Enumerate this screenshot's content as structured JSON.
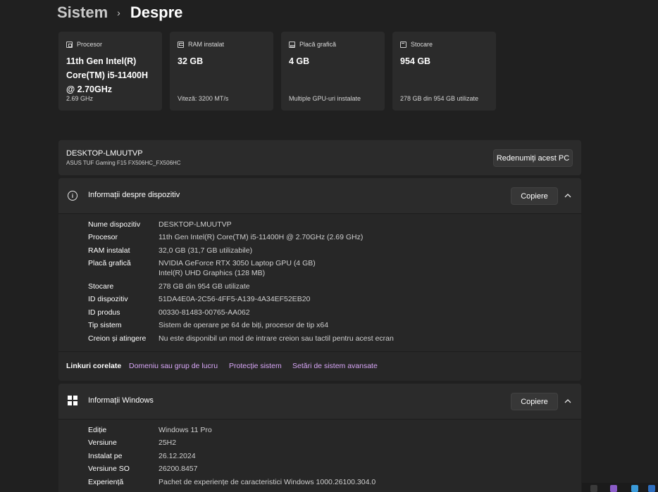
{
  "breadcrumb": {
    "parent": "Sistem",
    "separator": "›",
    "current": "Despre"
  },
  "specs": [
    {
      "icon": "processor-icon",
      "label": "Procesor",
      "value": "11th Gen Intel(R) Core(TM) i5-11400H @ 2.70GHz",
      "sub": "2.69 GHz"
    },
    {
      "icon": "ram-icon",
      "label": "RAM instalat",
      "value": "32 GB",
      "sub": "Viteză: 3200 MT/s"
    },
    {
      "icon": "gpu-icon",
      "label": "Placă grafică",
      "value": "4 GB",
      "sub": "Multiple GPU-uri instalate"
    },
    {
      "icon": "storage-icon",
      "label": "Stocare",
      "value": "954 GB",
      "sub": "278 GB din 954 GB utilizate"
    }
  ],
  "device": {
    "name": "DESKTOP-LMUUTVP",
    "model": "ASUS TUF Gaming F15 FX506HC_FX506HC",
    "rename_label": "Redenumiți acest PC"
  },
  "device_info": {
    "title": "Informații despre dispozitiv",
    "copy_label": "Copiere",
    "rows": [
      {
        "key": "Nume dispozitiv",
        "value": "DESKTOP-LMUUTVP"
      },
      {
        "key": "Procesor",
        "value": "11th Gen Intel(R) Core(TM) i5-11400H @ 2.70GHz (2.69 GHz)"
      },
      {
        "key": "RAM instalat",
        "value": "32,0 GB (31,7 GB utilizabile)"
      },
      {
        "key": "Placă grafică",
        "value": "NVIDIA GeForce RTX 3050 Laptop GPU (4 GB)",
        "value2": "Intel(R) UHD Graphics (128 MB)"
      },
      {
        "key": "Stocare",
        "value": "278 GB din 954 GB utilizate"
      },
      {
        "key": "ID dispozitiv",
        "value": "51DA4E0A-2C56-4FF5-A139-4A34EF52EB20"
      },
      {
        "key": "ID produs",
        "value": "00330-81483-00765-AA062"
      },
      {
        "key": "Tip sistem",
        "value": "Sistem de operare pe 64 de biți, procesor de tip x64"
      },
      {
        "key": "Creion și atingere",
        "value": "Nu este disponibil un mod de intrare creion sau tactil pentru acest ecran"
      }
    ]
  },
  "related": {
    "title": "Linkuri corelate",
    "links": [
      "Domeniu sau grup de lucru",
      "Protecție sistem",
      "Setări de sistem avansate"
    ]
  },
  "windows_info": {
    "title": "Informații Windows",
    "copy_label": "Copiere",
    "rows": [
      {
        "key": "Ediție",
        "value": "Windows 11 Pro"
      },
      {
        "key": "Versiune",
        "value": "25H2"
      },
      {
        "key": "Instalat pe",
        "value": "26.12.2024"
      },
      {
        "key": "Versiune SO",
        "value": "26200.8457"
      },
      {
        "key": "Experiență",
        "value": "Pachet de experiențe de caracteristici Windows 1000.26100.304.0"
      }
    ]
  },
  "colors": {
    "background": "#202020",
    "card": "#2b2b2b",
    "link": "#d7a6f6"
  }
}
